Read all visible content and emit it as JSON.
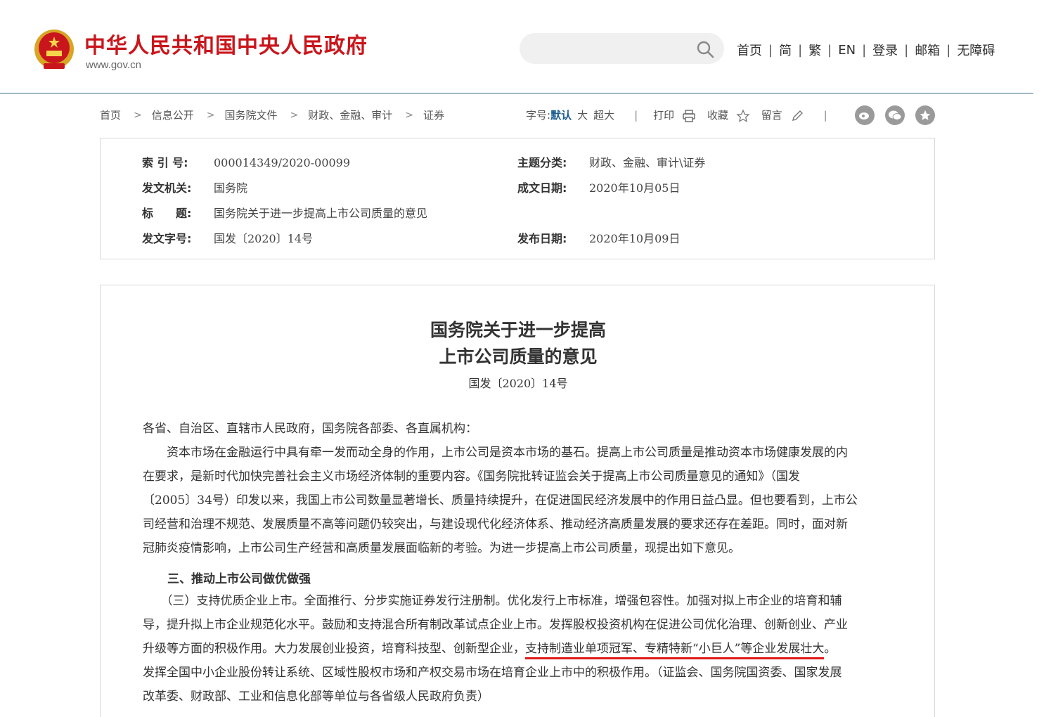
{
  "header": {
    "site_title": "中华人民共和国中央人民政府",
    "site_url": "www.gov.cn",
    "search_placeholder": "",
    "nav": [
      "首页",
      "简",
      "繁",
      "EN",
      "登录",
      "邮箱",
      "无障碍"
    ],
    "colors": {
      "brand_red": "#c9161c",
      "line": "#3d6f88",
      "link_active": "#1a5f93"
    }
  },
  "breadcrumb": [
    "首页",
    "信息公开",
    "国务院文件",
    "财政、金融、审计",
    "证券"
  ],
  "toolbar": {
    "font_label": "字号:",
    "font_default": "默认",
    "font_large": "大",
    "font_xlarge": "超大",
    "print": "打印",
    "favorite": "收藏",
    "comment": "留言"
  },
  "info": {
    "index_label": "索 引 号:",
    "index_value": "000014349/2020-00099",
    "topic_label": "主题分类:",
    "topic_value": "财政、金融、审计\\证券",
    "issuer_label": "发文机关:",
    "issuer_value": "国务院",
    "created_label": "成文日期:",
    "created_value": "2020年10月05日",
    "title_label": "标　　题:",
    "title_value": "国务院关于进一步提高上市公司质量的意见",
    "docno_label": "发文字号:",
    "docno_value": "国发〔2020〕14号",
    "published_label": "发布日期:",
    "published_value": "2020年10月09日"
  },
  "article": {
    "title_line1": "国务院关于进一步提高",
    "title_line2": "上市公司质量的意见",
    "doc_number": "国发〔2020〕14号",
    "salutation": "各省、自治区、直辖市人民政府，国务院各部委、各直属机构：",
    "intro_lines": [
      "　　资本市场在金融运行中具有牵一发而动全身的作用，上市公司是资本市场的基石。提高上市公司质量是推动资本市场健康发展的内",
      "在要求，是新时代加快完善社会主义市场经济体制的重要内容。《国务院批转证监会关于提高上市公司质量意见的通知》（国发",
      "〔2005〕34号）印发以来，我国上市公司数量显著增长、质量持续提升，在促进国民经济发展中的作用日益凸显。但也要看到，上市公",
      "司经营和治理不规范、发展质量不高等问题仍较突出，与建设现代化经济体系、推动经济高质量发展的要求还存在差距。同时，面对新",
      "冠肺炎疫情影响，上市公司生产经营和高质量发展面临新的考验。为进一步提高上市公司质量，现提出如下意见。"
    ],
    "section_heading": "三、推动上市公司做优做强",
    "section_lines": [
      "　　（三）支持优质企业上市。全面推行、分步实施证券发行注册制。优化发行上市标准，增强包容性。加强对拟上市企业的培育和辅",
      "导，提升拟上市企业规范化水平。鼓励和支持混合所有制改革试点企业上市。发挥股权投资机构在促进公司优化治理、创新创业、产业"
    ],
    "highlight_line_before": "升级等方面的积极作用。大力发展创业投资，培育科技型、创新型企业，",
    "highlight_text": "支持制造业单项冠军、专精特新“小巨人”等企业发展壮大",
    "highlight_line_after": "。",
    "tail_lines": [
      "发挥全国中小企业股份转让系统、区域性股权市场和产权交易市场在培育企业上市中的积极作用。（证监会、国务院国资委、国家发展",
      "改革委、财政部、工业和信息化部等单位与各省级人民政府负责）"
    ]
  }
}
